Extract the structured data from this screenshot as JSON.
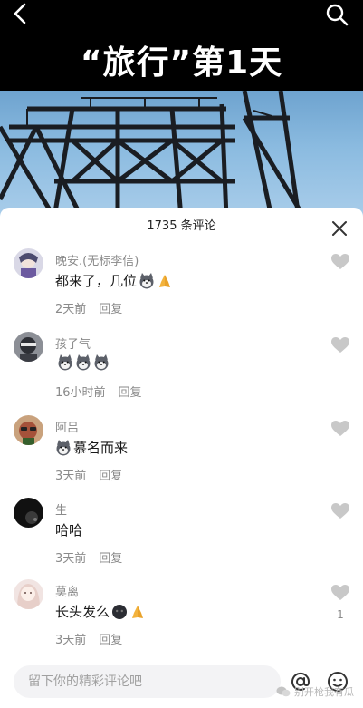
{
  "video": {
    "title": "“旅行”第1天"
  },
  "sheet": {
    "header": "1735 条评论"
  },
  "comments": [
    {
      "name": "晚安.(无标李信)",
      "text": "都来了，几位",
      "emojis": [
        "husky-emoji",
        "pray-emoji"
      ],
      "time": "2天前",
      "reply": "回复",
      "likes": ""
    },
    {
      "name": "孩子气",
      "text": "",
      "emojis": [
        "husky-emoji",
        "husky-emoji",
        "husky-emoji"
      ],
      "time": "16小时前",
      "reply": "回复",
      "likes": ""
    },
    {
      "name": "阿吕",
      "text": "慕名而来",
      "emojis": [
        "husky-emoji"
      ],
      "time": "3天前",
      "reply": "回复",
      "likes": ""
    },
    {
      "name": "生",
      "text": "哈哈",
      "emojis": [],
      "time": "3天前",
      "reply": "回复",
      "likes": ""
    },
    {
      "name": "莫离",
      "text": "长头发么",
      "emojis": [
        "dark-face-emoji",
        "pray-emoji"
      ],
      "time": "3天前",
      "reply": "回复",
      "likes": "1"
    }
  ],
  "input": {
    "placeholder": "留下你的精彩评论吧"
  },
  "watermark": {
    "text": "别开枪我有瓜"
  },
  "icons": {
    "back": "back-arrow-icon",
    "search": "search-icon",
    "close": "close-icon",
    "like": "heart-icon",
    "mention": "at-icon",
    "emoji": "emoji-face-icon"
  },
  "colors": {
    "sheet_bg": "#ffffff",
    "muted_text": "#8a8a8a",
    "heart": "#c8c8c8",
    "input_bg": "#f3f3f5"
  }
}
